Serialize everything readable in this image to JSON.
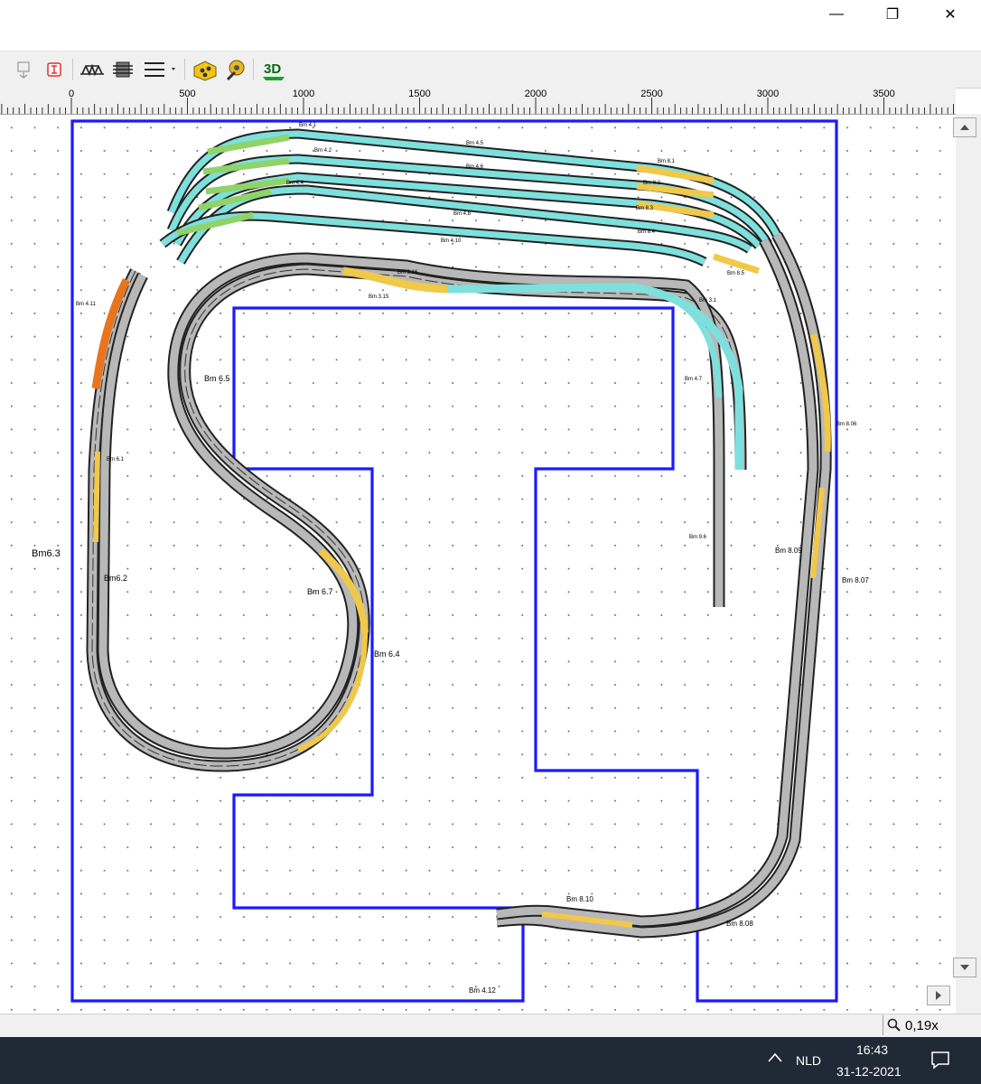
{
  "window": {
    "minimize_glyph": "—",
    "restore_glyph": "❐",
    "close_glyph": "✕"
  },
  "toolbar": {
    "threed_label": "3D"
  },
  "ruler": {
    "labels": [
      "0",
      "500",
      "1000",
      "1500",
      "2000",
      "2500",
      "3000",
      "3500"
    ]
  },
  "layout": {
    "board_color": "#1a1aff",
    "labels": {
      "bm41": "Bm 4.1",
      "bm42": "Bm 4.2",
      "bm43": "Bm 4.3",
      "bm44": "Bm 4.4",
      "bm45": "Bm 4.5",
      "bm46": "Bm 4.6",
      "bm47": "Bm 4.7",
      "bm48": "Bm 4.8",
      "bm49": "Bm 4.9",
      "bm410": "Bm 4.10",
      "bm411": "Bm 4.11",
      "bm412": "Bm 4.12",
      "bm81": "Bm 8.1",
      "bm82": "Bm 8.2",
      "bm83": "Bm 8.3",
      "bm84": "Bm 8.4",
      "bm85": "Bm 8.5",
      "bm86": "Bm 8.06",
      "bm87": "Bm 8.07",
      "bm88": "Bm 8.08",
      "bm89": "Bm 8.09",
      "bm810": "Bm 8.10",
      "bm31": "Bm 3.1",
      "bm315": "Bm 3.15",
      "bm316": "Bm 3.16",
      "bm61": "Bm 6.1",
      "bm62": "Bm6.2",
      "bm63": "Bm6.3",
      "bm64": "Bm 6.4",
      "bm65": "Bm 6.5",
      "bm67": "Bm 6.7",
      "bm96": "Bm 9.6",
      "bm97": "Bm 4.7"
    }
  },
  "status": {
    "zoom": "0,19x"
  },
  "taskbar": {
    "lang": "NLD",
    "time": "16:43",
    "date": "31-12-2021",
    "up_glyph": "^"
  }
}
